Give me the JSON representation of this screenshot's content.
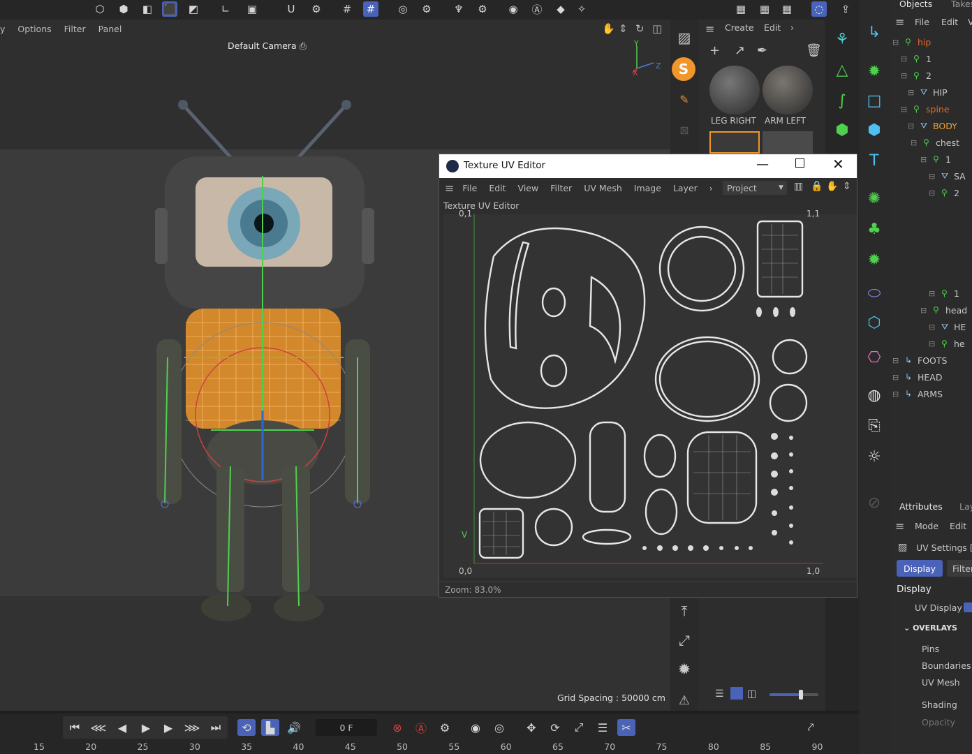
{
  "viewport": {
    "menu": [
      "y",
      "Options",
      "Filter",
      "Panel"
    ],
    "camera_label": "Default Camera",
    "grid_spacing": "Grid Spacing : 50000 cm",
    "axis_y": "Y",
    "axis_z": "Z",
    "axis_x": "X"
  },
  "materials": {
    "menu": [
      "Create",
      "Edit"
    ],
    "items": [
      "LEG RIGHT",
      "ARM LEFT"
    ]
  },
  "objects": {
    "tabs": [
      "Objects",
      "Takes"
    ],
    "menu": [
      "File",
      "Edit",
      "V"
    ],
    "tree": [
      {
        "label": "hip",
        "color": "#e06a2a"
      },
      {
        "label": "1",
        "color": "#c8c8c8"
      },
      {
        "label": "2",
        "color": "#c8c8c8"
      },
      {
        "label": "HIP",
        "color": "#c8c8c8"
      },
      {
        "label": "spine",
        "color": "#e06a2a"
      },
      {
        "label": "BODY",
        "color": "#f0a030"
      },
      {
        "label": "chest",
        "color": "#c8c8c8"
      },
      {
        "label": "1",
        "color": "#c8c8c8"
      },
      {
        "label": "SA",
        "color": "#c8c8c8"
      },
      {
        "label": "2",
        "color": "#c8c8c8"
      },
      {
        "label": "1",
        "color": "#c8c8c8"
      },
      {
        "label": "head",
        "color": "#c8c8c8"
      },
      {
        "label": "HE",
        "color": "#c8c8c8"
      },
      {
        "label": "he",
        "color": "#c8c8c8"
      },
      {
        "label": "FOOTS",
        "color": "#c8c8c8"
      },
      {
        "label": "HEAD",
        "color": "#c8c8c8"
      },
      {
        "label": "ARMS",
        "color": "#c8c8c8"
      }
    ]
  },
  "attributes": {
    "tabs": [
      "Attributes",
      "Lay"
    ],
    "menu": [
      "Mode",
      "Edit"
    ],
    "title": "UV Settings [",
    "subtabs": [
      "Display",
      "Filter"
    ],
    "section": "Display",
    "uv_display": "UV Display",
    "overlays": "OVERLAYS",
    "items": [
      "Pins",
      "Boundaries",
      "UV Mesh",
      "Shading",
      "Opacity"
    ]
  },
  "uv_editor": {
    "title": "Texture UV Editor",
    "menu": [
      "File",
      "Edit",
      "View",
      "Filter",
      "UV Mesh",
      "Image",
      "Layer"
    ],
    "project": "Project",
    "panel_label": "Texture UV Editor",
    "corner_tl": "0,1",
    "corner_tr": "1,1",
    "corner_bl": "0,0",
    "corner_br": "1,0",
    "v_label": "V",
    "zoom": "Zoom: 83.0%"
  },
  "timeline": {
    "frame": "0 F",
    "ticks": [
      "15",
      "20",
      "25",
      "30",
      "35",
      "40",
      "45",
      "50",
      "55",
      "60",
      "65",
      "70",
      "75",
      "80",
      "85",
      "90"
    ]
  },
  "colors": {
    "accent": "#4a62b8",
    "body_orange": "#f0962a",
    "rig_green": "#4fd04f"
  }
}
